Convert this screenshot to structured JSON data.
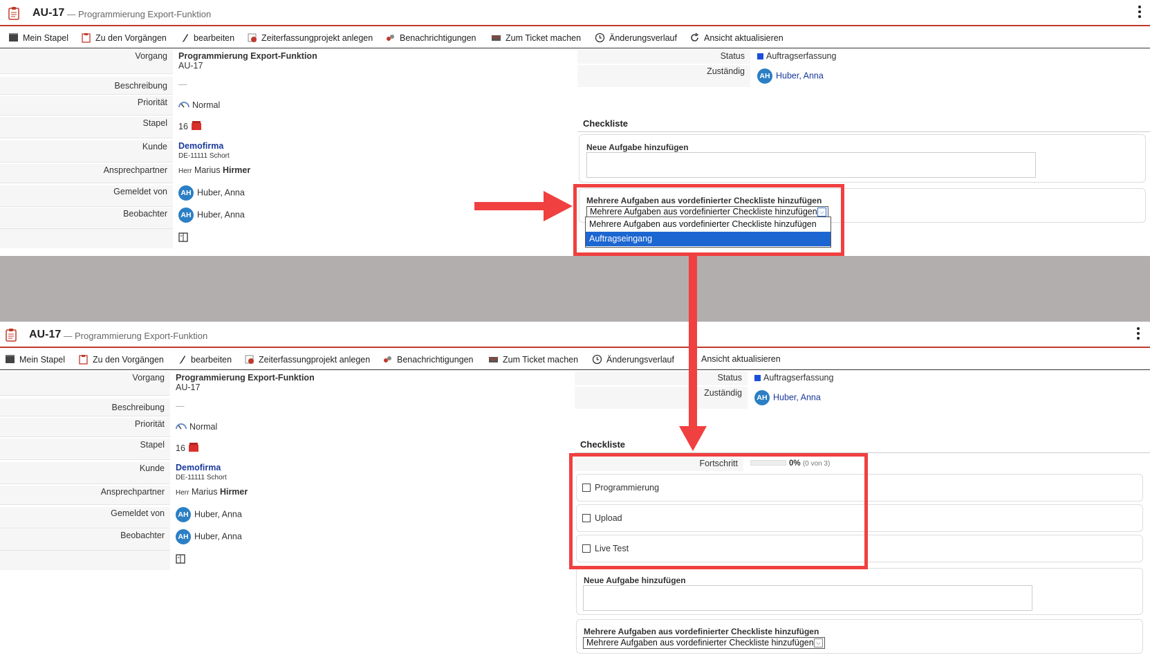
{
  "ticket": {
    "key": "AU-17",
    "separator": "—",
    "title": "Programmierung Export-Funktion"
  },
  "toolbar": [
    {
      "label": "Mein Stapel",
      "icon": "stack-icon"
    },
    {
      "label": "Zu den Vorgängen",
      "icon": "clipboard-icon"
    },
    {
      "label": "bearbeiten",
      "icon": "pencil-icon"
    },
    {
      "label": "Zeiterfassungprojekt anlegen",
      "icon": "time-project-icon"
    },
    {
      "label": "Benachrichtigungen",
      "icon": "notification-icon"
    },
    {
      "label": "Zum Ticket machen",
      "icon": "envelope-icon"
    },
    {
      "label": "Änderungsverlauf",
      "icon": "clock-icon"
    },
    {
      "label": "Ansicht aktualisieren",
      "icon": "refresh-icon"
    }
  ],
  "fields": {
    "vorgang_label": "Vorgang",
    "vorgang_title": "Programmierung Export-Funktion",
    "vorgang_key": "AU-17",
    "beschreibung_label": "Beschreibung",
    "beschreibung_value": "—",
    "prioritaet_label": "Priorität",
    "prioritaet_value": "Normal",
    "stapel_label": "Stapel",
    "stapel_value": "16",
    "kunde_label": "Kunde",
    "kunde_name": "Demofirma",
    "kunde_address": "DE-11111 Schort",
    "ansprech_label": "Ansprechpartner",
    "ansprech_salutation": "Herr",
    "ansprech_first": "Marius",
    "ansprech_last": "Hirmer",
    "gemeldet_label": "Gemeldet von",
    "gemeldet_initials": "AH",
    "gemeldet_name": "Huber, Anna",
    "beobachter_label": "Beobachter",
    "beobachter_initials": "AH",
    "beobachter_name": "Huber, Anna"
  },
  "right": {
    "status_label": "Status",
    "status_value": "Auftragserfassung",
    "zustaendig_label": "Zuständig",
    "zustaendig_initials": "AH",
    "zustaendig_name": "Huber, Anna"
  },
  "checklist": {
    "heading": "Checkliste",
    "new_task_label": "Neue Aufgabe hinzufügen",
    "multi_label": "Mehrere Aufgaben aus vordefinierter Checkliste hinzufügen",
    "select_value": "Mehrere Aufgaben aus vordefinierter Checkliste hinzufügen",
    "dropdown_options": [
      "Mehrere Aufgaben aus vordefinierter Checkliste hinzufügen",
      "Auftragseingang"
    ],
    "progress_label": "Fortschritt",
    "progress_percent_text": "0%",
    "progress_count_text": "(0 von 3)",
    "progress_fraction": 0,
    "tasks": [
      "Programmierung",
      "Upload",
      "Live Test"
    ]
  },
  "colors": {
    "accent_red": "#f04040",
    "header_red": "#c0392b",
    "avatar_blue": "#2b7fc4",
    "status_blue": "#1c4fd8",
    "dropdown_selected": "#1c66d2",
    "band_gray": "#b3aeae"
  }
}
